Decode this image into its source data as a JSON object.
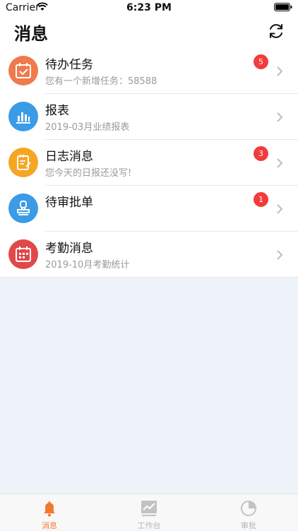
{
  "status_bar": {
    "carrier": "Carrier",
    "time": "6:23 PM"
  },
  "header": {
    "title": "消息",
    "refresh_icon": "refresh-icon"
  },
  "messages": [
    {
      "label": "待办任务",
      "subtitle": "您有一个新增任务：58588",
      "badge": "5",
      "icon": "calendar-check-icon",
      "color": "#ef7a4b"
    },
    {
      "label": "报表",
      "subtitle": "2019-03月业绩报表",
      "badge": "",
      "icon": "bar-chart-icon",
      "color": "#3a9be6"
    },
    {
      "label": "日志消息",
      "subtitle": "您今天的日报还没写!",
      "badge": "3",
      "icon": "notepad-icon",
      "color": "#f5a623"
    },
    {
      "label": "待审批单",
      "subtitle": "",
      "badge": "1",
      "icon": "stamp-icon",
      "color": "#3a9be6"
    },
    {
      "label": "考勤消息",
      "subtitle": "2019-10月考勤统计",
      "badge": "",
      "icon": "attendance-calendar-icon",
      "color": "#e14848"
    }
  ],
  "tabbar": [
    {
      "label": "消息",
      "icon": "bell-icon",
      "active": true
    },
    {
      "label": "工作台",
      "icon": "workbench-chart-icon",
      "active": false
    },
    {
      "label": "审批",
      "icon": "pie-chart-icon",
      "active": false
    }
  ]
}
